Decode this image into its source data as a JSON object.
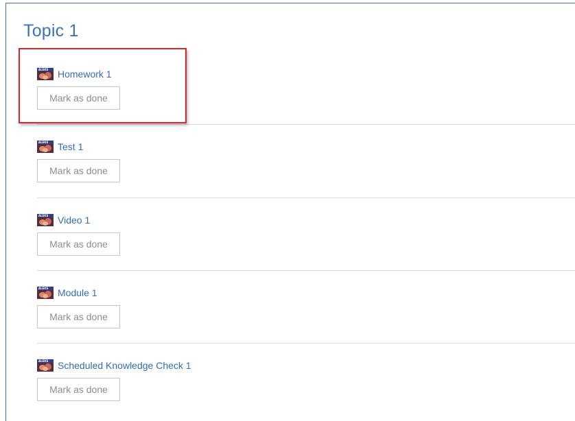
{
  "topic": {
    "title": "Topic 1"
  },
  "activities": [
    {
      "label": "Homework 1",
      "icon": "aleks-icon",
      "button": "Mark as done"
    },
    {
      "label": "Test 1",
      "icon": "aleks-icon",
      "button": "Mark as done"
    },
    {
      "label": "Video 1",
      "icon": "aleks-icon",
      "button": "Mark as done"
    },
    {
      "label": "Module 1",
      "icon": "aleks-icon",
      "button": "Mark as done"
    },
    {
      "label": "Scheduled Knowledge Check 1",
      "icon": "aleks-icon",
      "button": "Mark as done"
    }
  ],
  "colors": {
    "title": "#3b73b9",
    "link": "#2f6db8",
    "highlight": "#d9262c",
    "button_text": "#8d8d8d",
    "button_border": "#c6c6c6",
    "divider": "#dcdcdc"
  }
}
